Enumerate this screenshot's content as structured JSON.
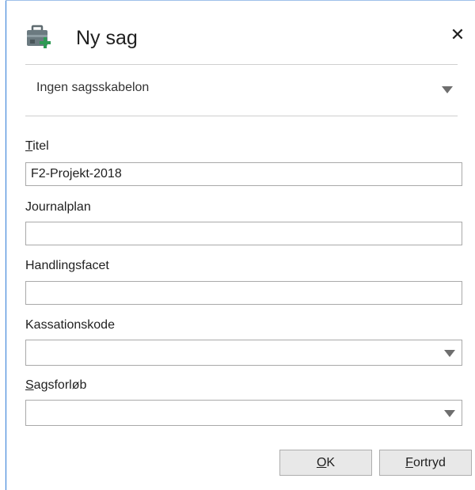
{
  "dialog": {
    "title": "Ny sag",
    "close_symbol": "✕",
    "icon": "case-add-icon"
  },
  "template": {
    "selected": "Ingen sagsskabelon"
  },
  "fields": {
    "titel": {
      "label_access_key": "T",
      "label_rest": "itel",
      "value": "F2-Projekt-2018"
    },
    "journalplan": {
      "label": "Journalplan",
      "value": ""
    },
    "handlingsfacet": {
      "label": "Handlingsfacet",
      "value": ""
    },
    "kassationskode": {
      "label": "Kassationskode",
      "selected": ""
    },
    "sagsforloeb": {
      "label_access_key": "S",
      "label_rest": "agsforløb",
      "selected": ""
    }
  },
  "buttons": {
    "ok": {
      "access_key": "O",
      "rest": "K"
    },
    "cancel": {
      "access_key": "F",
      "rest": "ortryd"
    }
  },
  "colors": {
    "frame_accent": "#2e7bd6",
    "button_bg": "#e8e8e8",
    "border": "#a9a9a9"
  }
}
